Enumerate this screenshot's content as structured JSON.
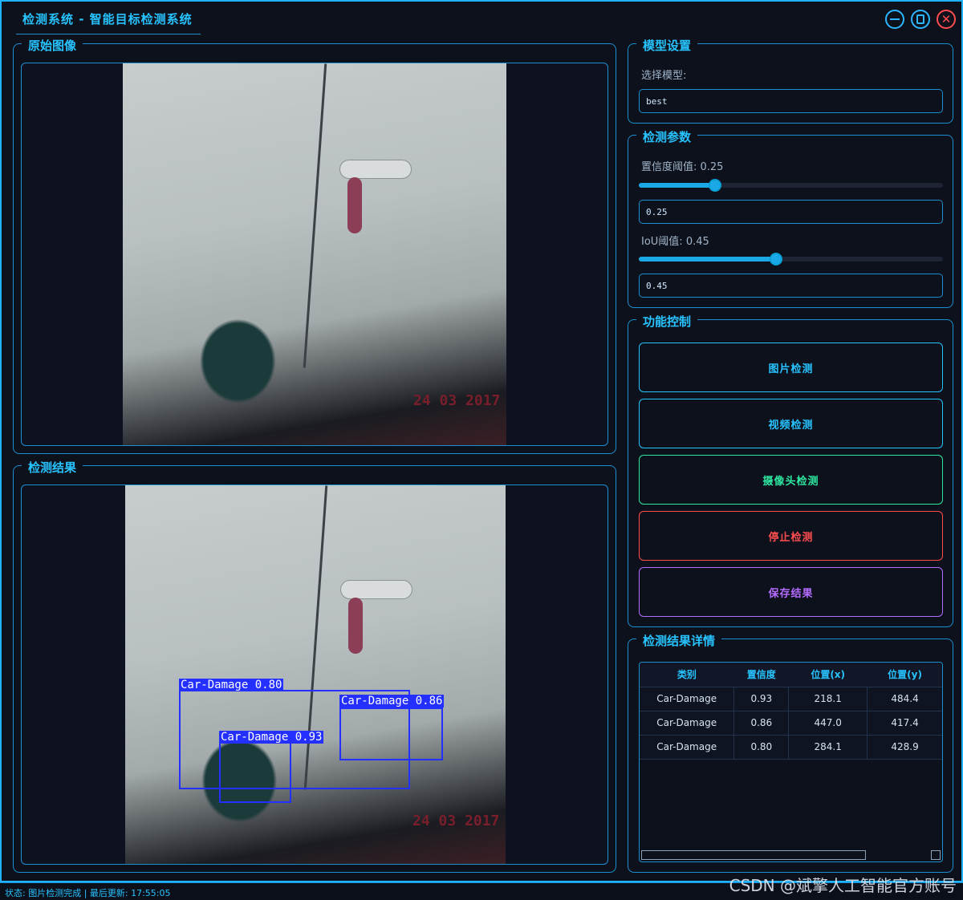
{
  "window": {
    "title": "检测系统 - 智能目标检测系统"
  },
  "original_panel": {
    "title": "原始图像"
  },
  "result_panel": {
    "title": "检测结果",
    "photo_stamp": "24 03 2017",
    "detections": [
      {
        "label": "Car-Damage 0.80"
      },
      {
        "label": "Car-Damage 0.86"
      },
      {
        "label": "Car-Damage 0.93"
      }
    ]
  },
  "original_photo_stamp": "24 03 2017",
  "model_settings": {
    "title": "模型设置",
    "select_label": "选择模型:",
    "selected_model": "best"
  },
  "detect_params": {
    "title": "检测参数",
    "confidence_label": "置信度阈值: 0.25",
    "confidence_value": "0.25",
    "confidence_level": 0.25,
    "iou_label": "IoU阈值: 0.45",
    "iou_value": "0.45",
    "iou_level": 0.45
  },
  "function_control": {
    "title": "功能控制",
    "image_detect": "图片检测",
    "video_detect": "视频检测",
    "camera_detect": "摄像头检测",
    "stop_detect": "停止检测",
    "save_results": "保存结果",
    "colors": {
      "image": "#27c3ff",
      "video": "#27c3ff",
      "camera": "#2ee8a0",
      "stop": "#ff4d4f",
      "save": "#b46bff"
    }
  },
  "results_detail": {
    "title": "检测结果详情",
    "columns": [
      "类别",
      "置信度",
      "位置(x)",
      "位置(y)"
    ],
    "rows": [
      [
        "Car-Damage",
        "0.93",
        "218.1",
        "484.4"
      ],
      [
        "Car-Damage",
        "0.86",
        "447.0",
        "417.4"
      ],
      [
        "Car-Damage",
        "0.80",
        "284.1",
        "428.9"
      ]
    ]
  },
  "status": {
    "text": "状态: 图片检测完成 | 最后更新: 17:55:05"
  },
  "watermark": "CSDN @斌擎人工智能官方账号"
}
